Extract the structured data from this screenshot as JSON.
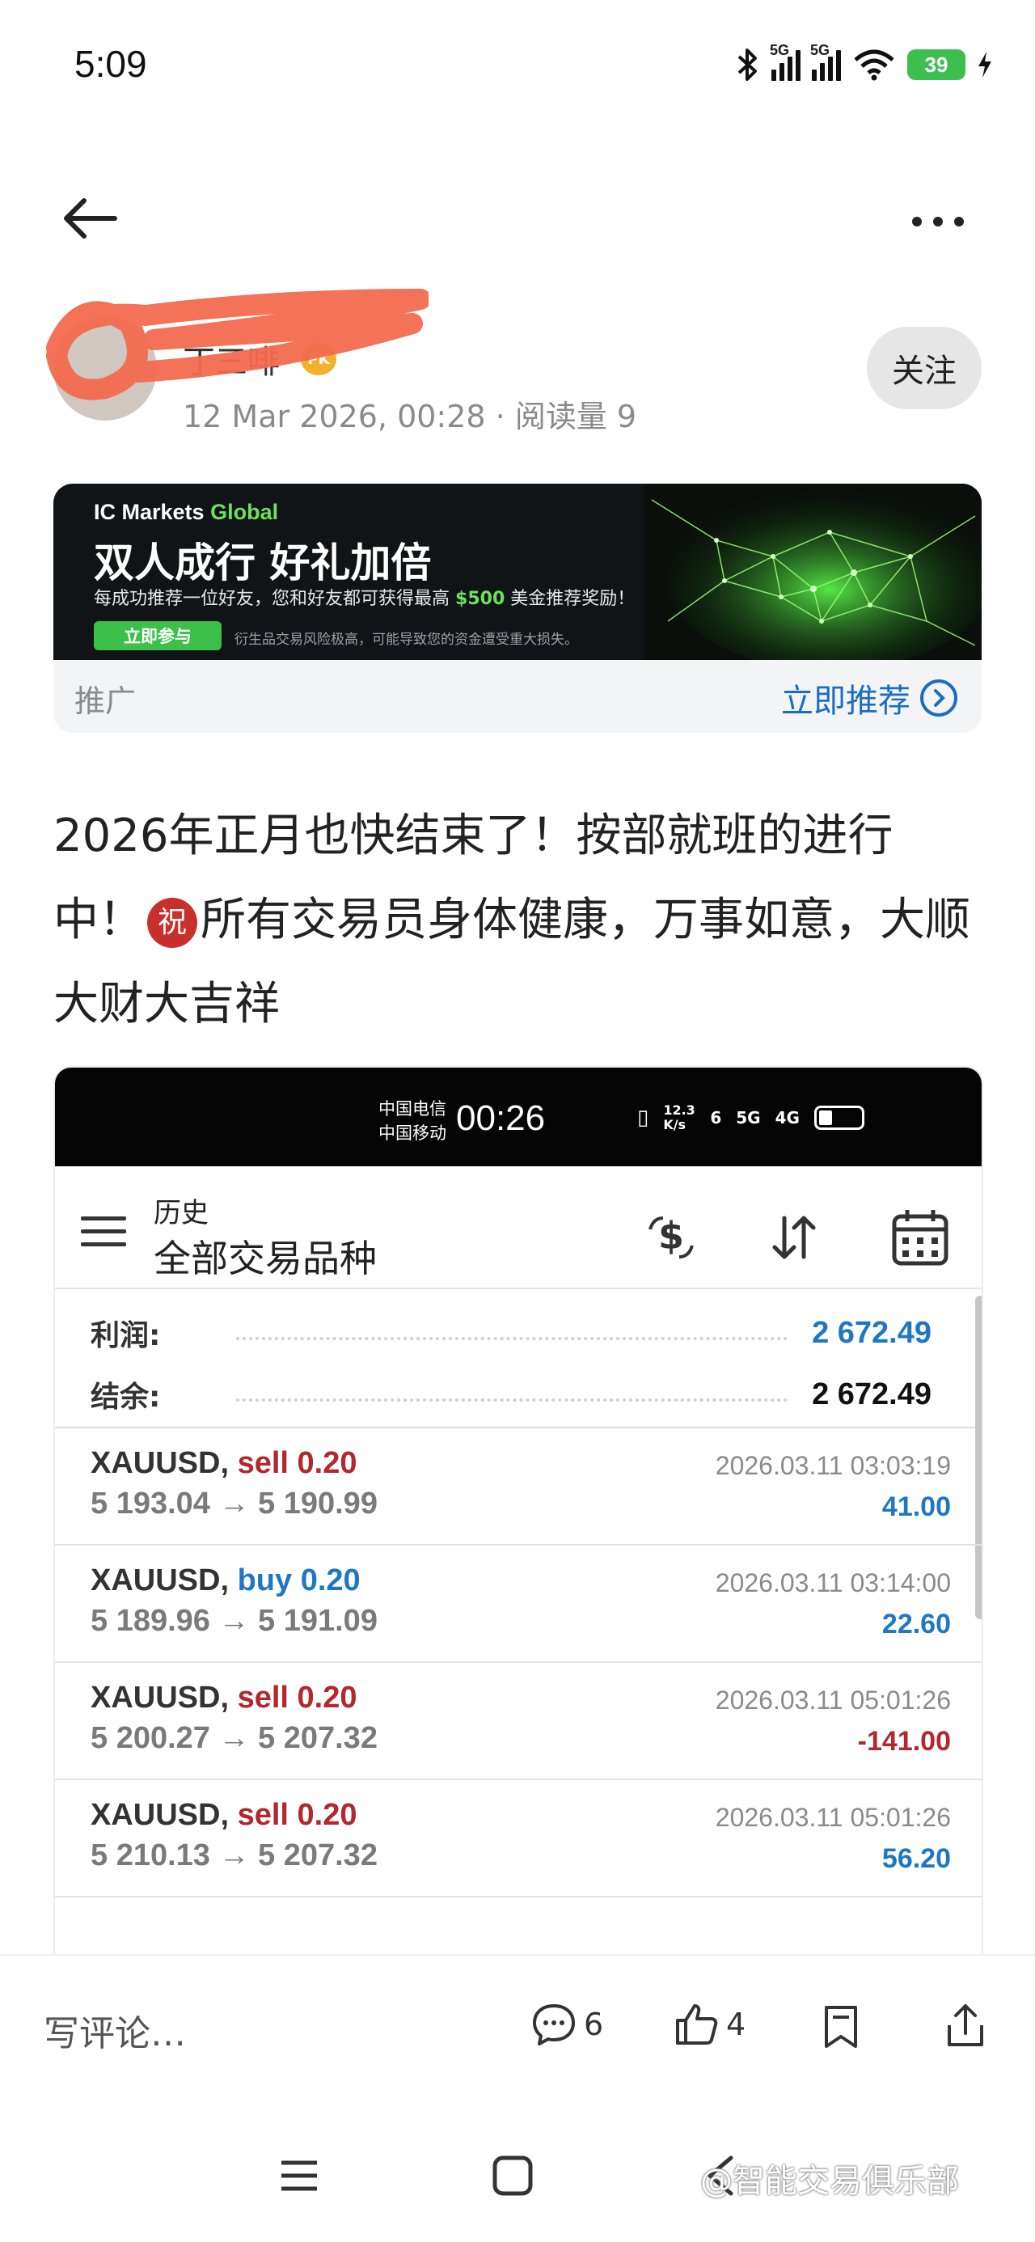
{
  "status_bar": {
    "time": "5:09",
    "battery": "39",
    "network_1": "5G",
    "network_2": "5G"
  },
  "author": {
    "name": "丁三啡",
    "badge": "PK",
    "meta": "12 Mar 2026, 00:28 · 阅读量 9",
    "follow_label": "关注"
  },
  "ad": {
    "logo": "IC Markets",
    "logo_suffix": "Global",
    "headline": "双人成行 好礼加倍",
    "subtext_before": "每成功推荐一位好友，您和好友都可获得最高",
    "subtext_amount": "$500",
    "subtext_after": "美金推荐奖励！",
    "cta": "立即参与",
    "risk": "衍生品交易风险极高，可能导致您的资金遭受重大损失。",
    "label": "推广",
    "link": "立即推荐"
  },
  "post": {
    "text_part1": "2026年正月也快结束了！按部就班的进行中！",
    "emoji": "祝",
    "text_part2": "所有交易员身体健康，万事如意，大顺大财大吉祥"
  },
  "shot": {
    "carrier_1": "中国电信",
    "carrier_2": "中国移动",
    "time": "00:26",
    "speed": "12.3 K/s",
    "net_labels": [
      "6",
      "5G",
      "4G"
    ],
    "header_title": "历史",
    "header_subtitle": "全部交易品种",
    "summary": {
      "profit_label": "利润:",
      "profit_value": "2 672.49",
      "balance_label": "结余:",
      "balance_value": "2 672.49"
    },
    "trades": [
      {
        "symbol": "XAUUSD,",
        "side": "sell 0.20",
        "prices": "5 193.04 → 5 190.99",
        "time": "2026.03.11 03:03:19",
        "pl": "41.00",
        "side_type": "sell",
        "pl_type": "pos"
      },
      {
        "symbol": "XAUUSD,",
        "side": "buy 0.20",
        "prices": "5 189.96 → 5 191.09",
        "time": "2026.03.11 03:14:00",
        "pl": "22.60",
        "side_type": "buy",
        "pl_type": "pos"
      },
      {
        "symbol": "XAUUSD,",
        "side": "sell 0.20",
        "prices": "5 200.27 → 5 207.32",
        "time": "2026.03.11 05:01:26",
        "pl": "-141.00",
        "side_type": "sell",
        "pl_type": "neg"
      },
      {
        "symbol": "XAUUSD,",
        "side": "sell 0.20",
        "prices": "5 210.13 → 5 207.32",
        "time": "2026.03.11 05:01:26",
        "pl": "56.20",
        "side_type": "sell",
        "pl_type": "pos"
      }
    ]
  },
  "action_bar": {
    "comment_placeholder": "写评论…",
    "comment_count": "6",
    "like_count": "4"
  },
  "watermark": "@智能交易俱乐部",
  "colors": {
    "profit_blue": "#1f77c4",
    "loss_red": "#b3272d",
    "ad_green": "#3cc04a",
    "link_blue": "#1a6dc2"
  }
}
